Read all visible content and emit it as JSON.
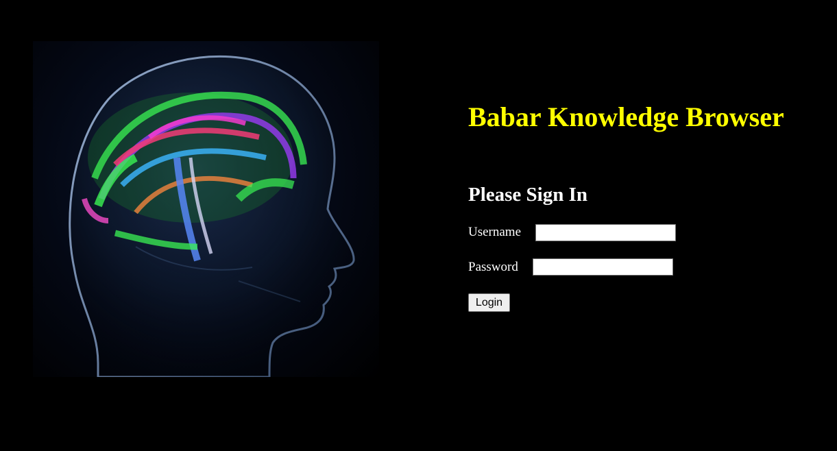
{
  "header": {
    "title": "Babar Knowledge Browser"
  },
  "login_form": {
    "heading": "Please Sign In",
    "username_label": "Username",
    "username_value": "",
    "password_label": "Password",
    "password_value": "",
    "submit_label": "Login"
  },
  "hero_image": {
    "icon": "brain-scan-head-image"
  },
  "colors": {
    "background": "#000000",
    "title": "#ffff00",
    "text": "#ffffff"
  }
}
